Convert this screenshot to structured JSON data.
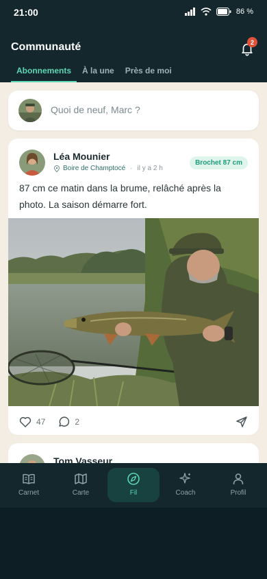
{
  "status": {
    "time": "21:00",
    "battery": "86 %"
  },
  "header": {
    "title": "Communauté",
    "notification_count": "2",
    "tabs": [
      {
        "label": "Abonnements",
        "active": true
      },
      {
        "label": "À la une",
        "active": false
      },
      {
        "label": "Près de moi",
        "active": false
      }
    ]
  },
  "composer": {
    "placeholder": "Quoi de neuf, Marc ?"
  },
  "posts": [
    {
      "author": "Léa Mounier",
      "location": "Boire de Champtocé",
      "time": "il y a 2 h",
      "badge": "Brochet 87 cm",
      "text": "87 cm ce matin dans la brume, relâché après la photo. La saison démarre fort.",
      "likes": "47",
      "comments": "2"
    },
    {
      "author": "Tom Vasseur"
    }
  ],
  "nav": {
    "items": [
      {
        "label": "Carnet",
        "icon": "book-icon"
      },
      {
        "label": "Carte",
        "icon": "map-icon"
      },
      {
        "label": "Fil",
        "icon": "compass-icon",
        "active": true
      },
      {
        "label": "Coach",
        "icon": "sparkles-icon"
      },
      {
        "label": "Profil",
        "icon": "user-icon"
      }
    ]
  },
  "colors": {
    "accent": "#5dd6b4",
    "header_bg": "#13272d",
    "feed_bg": "#f3ede4",
    "badge_red": "#e0513a"
  }
}
